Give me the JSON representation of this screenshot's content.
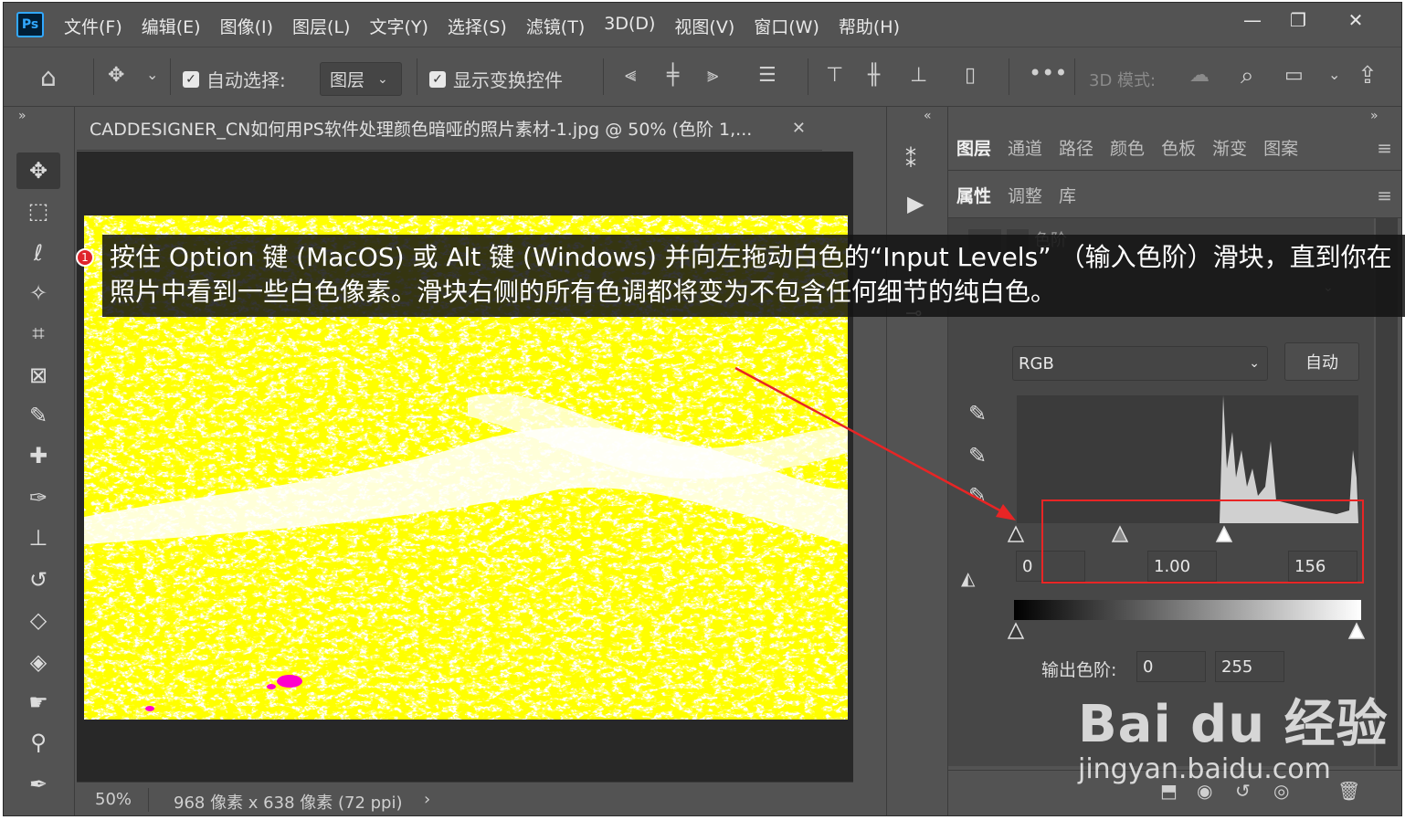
{
  "menubar": {
    "logo": "Ps",
    "items": [
      "文件(F)",
      "编辑(E)",
      "图像(I)",
      "图层(L)",
      "文字(Y)",
      "选择(S)",
      "滤镜(T)",
      "3D(D)",
      "视图(V)",
      "窗口(W)",
      "帮助(H)"
    ]
  },
  "optionsbar": {
    "auto_select_label": "自动选择:",
    "auto_select_value": "图层",
    "show_transform_label": "显示变换控件",
    "mode_3d_label": "3D 模式:"
  },
  "document": {
    "tab_title": "CADDESIGNER_CN如何用PS软件处理颜色暗哑的照片素材-1.jpg @ 50% (色阶 1,...",
    "zoom": "50%",
    "dimensions": "968 像素 x 638 像素 (72 ppi)"
  },
  "panel_tabs_top": [
    "图层",
    "通道",
    "路径",
    "颜色",
    "色板",
    "渐变",
    "图案"
  ],
  "panel_tabs_second": [
    "属性",
    "调整",
    "库"
  ],
  "levels": {
    "channel": "RGB",
    "auto_label": "自动",
    "input_black": "0",
    "input_gamma": "1.00",
    "input_white": "156",
    "output_label": "输出色阶:",
    "output_black": "0",
    "output_white": "255",
    "faded_label": "色阶"
  },
  "annotation": {
    "bullet": "1",
    "text": "按住 Option 键 (MacOS) 或 Alt 键 (Windows) 并向左拖动白色的“Input Levels” （输入色阶）滑块，直到你在照片中看到一些白色像素。滑块右侧的所有色调都将变为不包含任何细节的纯白色。"
  },
  "watermark": {
    "brand": "Bai du 经验",
    "url": "jingyan.baidu.com"
  },
  "colors": {
    "ui_bg": "#535353",
    "canvas_bg": "#282828",
    "image_yellow": "#ffff00",
    "highlight_red": "#e82525"
  }
}
